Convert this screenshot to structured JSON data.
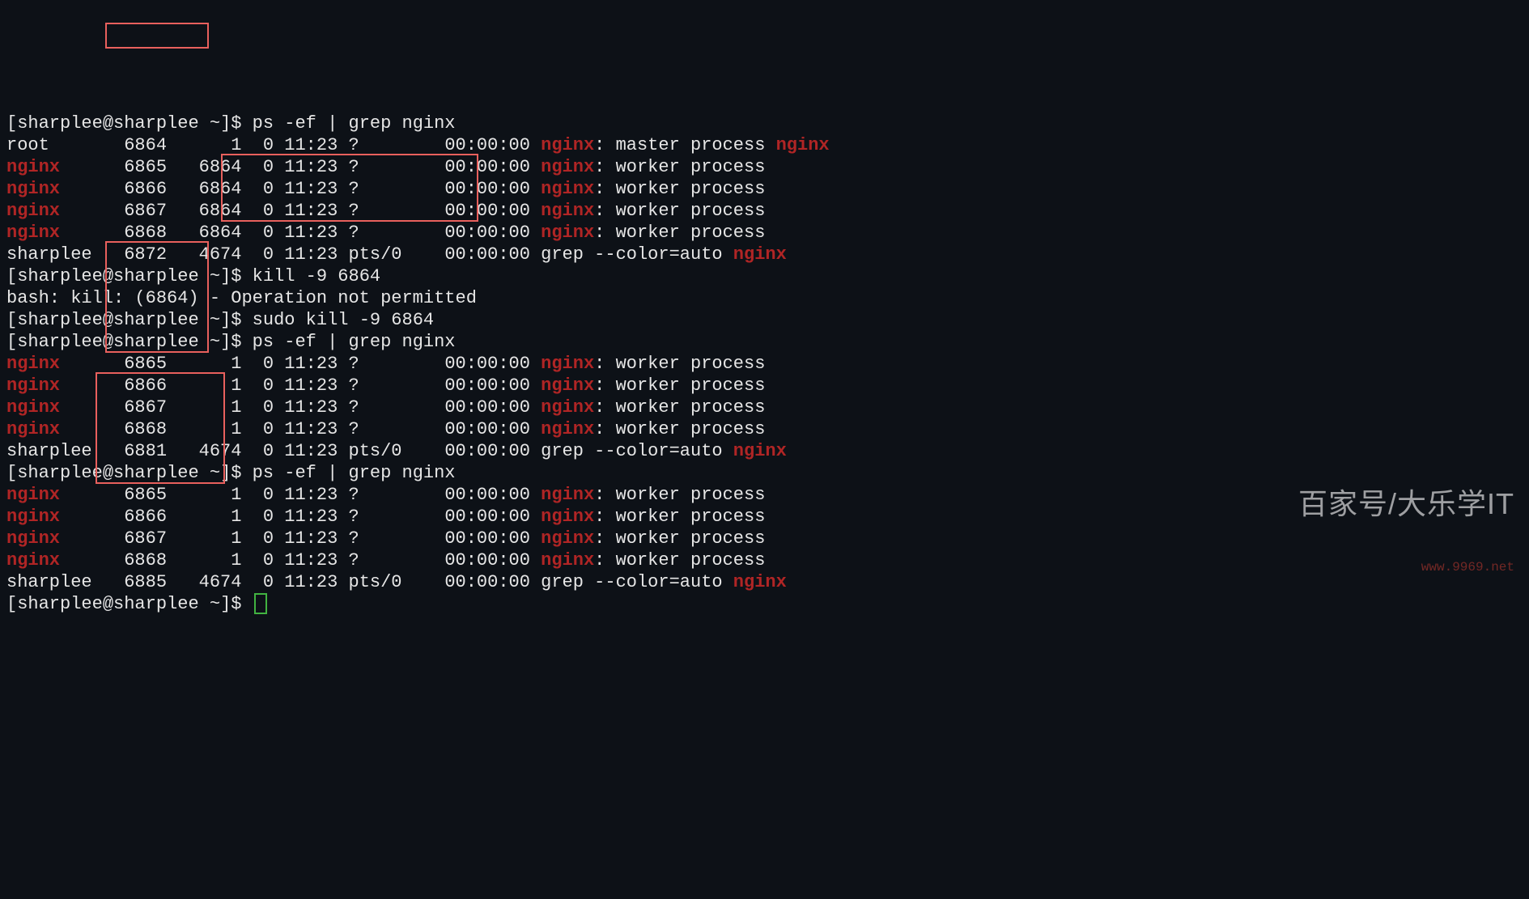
{
  "prompt": {
    "user": "sharplee",
    "host": "sharplee",
    "cwd": "~",
    "endchar": "$"
  },
  "cmd": {
    "ps": "ps -ef | grep nginx",
    "kill": "kill -9 6864",
    "sudokill": "sudo kill -9 6864"
  },
  "err": {
    "kill": "bash: kill: (6864) - Operation not permitted"
  },
  "nginx_word": "nginx",
  "ps1": {
    "r0": {
      "uid": "root",
      "pid": "6864",
      "ppid": "1",
      "c": "0",
      "stime": "11:23",
      "tty": "?",
      "time": "00:00:00",
      "pre": ": master process "
    },
    "r1": {
      "uid": "nginx",
      "pid": "6865",
      "ppid": "6864",
      "c": "0",
      "stime": "11:23",
      "tty": "?",
      "time": "00:00:00",
      "desc": ": worker process"
    },
    "r2": {
      "uid": "nginx",
      "pid": "6866",
      "ppid": "6864",
      "c": "0",
      "stime": "11:23",
      "tty": "?",
      "time": "00:00:00",
      "desc": ": worker process"
    },
    "r3": {
      "uid": "nginx",
      "pid": "6867",
      "ppid": "6864",
      "c": "0",
      "stime": "11:23",
      "tty": "?",
      "time": "00:00:00",
      "desc": ": worker process"
    },
    "r4": {
      "uid": "nginx",
      "pid": "6868",
      "ppid": "6864",
      "c": "0",
      "stime": "11:23",
      "tty": "?",
      "time": "00:00:00",
      "desc": ": worker process"
    },
    "r5": {
      "uid": "sharplee",
      "pid": "6872",
      "ppid": "4674",
      "c": "0",
      "stime": "11:23",
      "tty": "pts/0",
      "time": "00:00:00",
      "desc": "grep --color=auto "
    }
  },
  "ps2": {
    "r0": {
      "uid": "nginx",
      "pid": "6865",
      "ppid": "1",
      "c": "0",
      "stime": "11:23",
      "tty": "?",
      "time": "00:00:00",
      "desc": ": worker process"
    },
    "r1": {
      "uid": "nginx",
      "pid": "6866",
      "ppid": "1",
      "c": "0",
      "stime": "11:23",
      "tty": "?",
      "time": "00:00:00",
      "desc": ": worker process"
    },
    "r2": {
      "uid": "nginx",
      "pid": "6867",
      "ppid": "1",
      "c": "0",
      "stime": "11:23",
      "tty": "?",
      "time": "00:00:00",
      "desc": ": worker process"
    },
    "r3": {
      "uid": "nginx",
      "pid": "6868",
      "ppid": "1",
      "c": "0",
      "stime": "11:23",
      "tty": "?",
      "time": "00:00:00",
      "desc": ": worker process"
    },
    "r4": {
      "uid": "sharplee",
      "pid": "6881",
      "ppid": "4674",
      "c": "0",
      "stime": "11:23",
      "tty": "pts/0",
      "time": "00:00:00",
      "desc": "grep --color=auto "
    }
  },
  "ps3": {
    "r0": {
      "uid": "nginx",
      "pid": "6865",
      "ppid": "1",
      "c": "0",
      "stime": "11:23",
      "tty": "?",
      "time": "00:00:00",
      "desc": ": worker process"
    },
    "r1": {
      "uid": "nginx",
      "pid": "6866",
      "ppid": "1",
      "c": "0",
      "stime": "11:23",
      "tty": "?",
      "time": "00:00:00",
      "desc": ": worker process"
    },
    "r2": {
      "uid": "nginx",
      "pid": "6867",
      "ppid": "1",
      "c": "0",
      "stime": "11:23",
      "tty": "?",
      "time": "00:00:00",
      "desc": ": worker process"
    },
    "r3": {
      "uid": "nginx",
      "pid": "6868",
      "ppid": "1",
      "c": "0",
      "stime": "11:23",
      "tty": "?",
      "time": "00:00:00",
      "desc": ": worker process"
    },
    "r4": {
      "uid": "sharplee",
      "pid": "6885",
      "ppid": "4674",
      "c": "0",
      "stime": "11:23",
      "tty": "pts/0",
      "time": "00:00:00",
      "desc": "grep --color=auto "
    }
  },
  "watermark": {
    "main": "百家号/大乐学IT",
    "sub": "www.9969.net"
  },
  "highlight_color": "#e8605d"
}
